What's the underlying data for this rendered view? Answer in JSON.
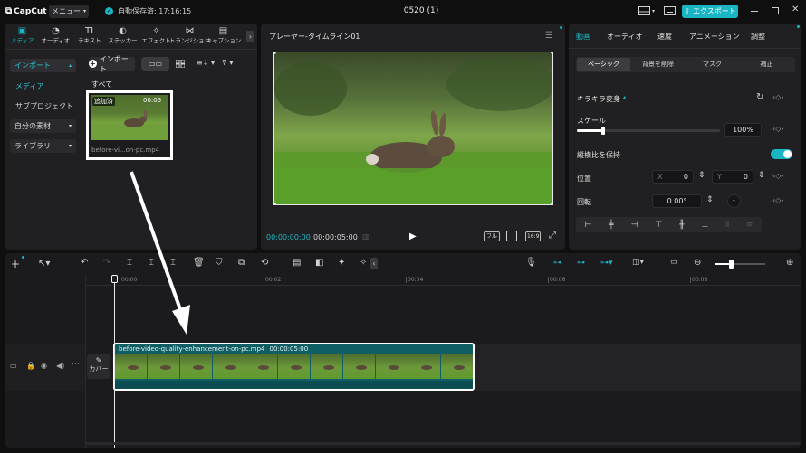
{
  "app": {
    "logo": "CapCut",
    "menu_label": "メニュー",
    "autosave": "自動保存済: 17:16:15",
    "project_title": "0520 (1)",
    "export_label": "エクスポート"
  },
  "media_tabs": [
    {
      "label": "メディア",
      "icon": "media-icon"
    },
    {
      "label": "オーディオ",
      "icon": "audio-icon"
    },
    {
      "label": "テキスト",
      "icon": "text-icon"
    },
    {
      "label": "ステッカー",
      "icon": "sticker-icon"
    },
    {
      "label": "エフェクト",
      "icon": "effect-icon"
    },
    {
      "label": "トランジション",
      "icon": "transition-icon"
    },
    {
      "label": "キャプション",
      "icon": "caption-icon"
    }
  ],
  "sidebar": {
    "import": "インポート",
    "media": "メディア",
    "subproject": "サブプロジェクト",
    "my_assets": "自分の素材",
    "library": "ライブラリ"
  },
  "media_panel": {
    "import_button": "インポート",
    "all_label": "すべて",
    "clip": {
      "badge": "追加済",
      "duration": "00:05",
      "filename": "before-vi...on-pc.mp4"
    }
  },
  "player": {
    "title": "プレーヤー-タイムライン01",
    "current_time": "00:00:00:00",
    "total_time": "00:00:05:00",
    "full_label": "フル",
    "ratio_label": "16:9"
  },
  "props": {
    "tabs": [
      "動画",
      "オーディオ",
      "速度",
      "アニメーション",
      "調整"
    ],
    "subtabs": [
      "ベーシック",
      "背景を削除",
      "マスク",
      "補正"
    ],
    "section": "キラキラ変身",
    "scale_label": "スケール",
    "scale_value": "100%",
    "scale_fraction": 1.0,
    "keep_ratio_label": "縦横比を保持",
    "keep_ratio_on": true,
    "position_label": "位置",
    "pos_x_label": "X",
    "pos_x": "0",
    "pos_y_label": "Y",
    "pos_y": "0",
    "rotation_label": "回転",
    "rotation_value": "0.00°"
  },
  "timeline": {
    "ruler": [
      "00:00",
      "00:02",
      "00:04",
      "00:06",
      "00:08"
    ],
    "cover_label": "カバー",
    "clip_name": "before-video-quality-enhancement-on-pc.mp4",
    "clip_duration": "00:00:05:00"
  }
}
